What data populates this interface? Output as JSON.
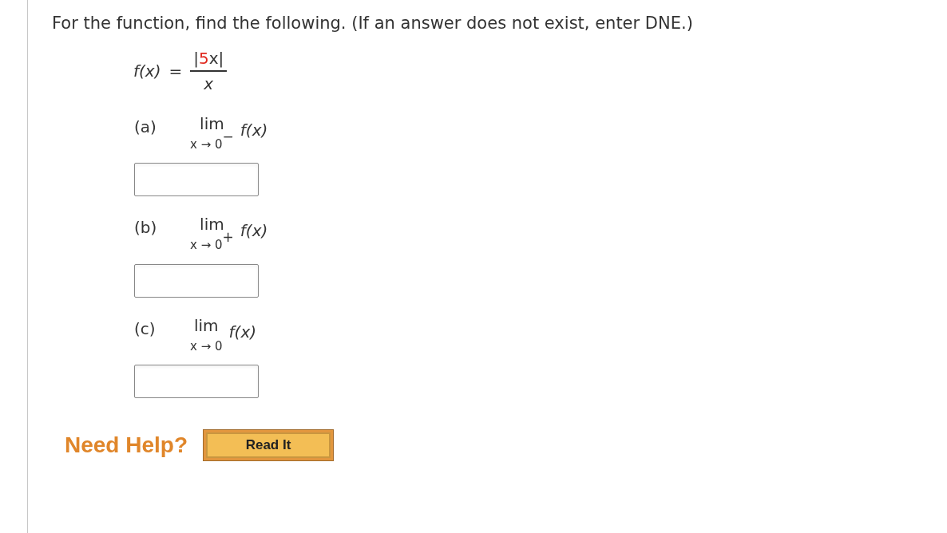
{
  "instruction": "For the function, find the following. (If an answer does not exist, enter DNE.)",
  "function": {
    "name": "f(x)",
    "equals": "=",
    "numerator": [
      {
        "text": "|",
        "color": "#333333"
      },
      {
        "text": "5",
        "color": "#e0281e"
      },
      {
        "text": "x|",
        "color": "#333333"
      }
    ],
    "denominator": "x"
  },
  "parts": [
    {
      "label": "(a)",
      "operator": "lim",
      "approach": "x → 0",
      "side": "−",
      "expression": "f(x)"
    },
    {
      "label": "(b)",
      "operator": "lim",
      "approach": "x → 0",
      "side": "+",
      "expression": "f(x)"
    },
    {
      "label": "(c)",
      "operator": "lim",
      "approach": "x → 0",
      "expression": "f(x)"
    }
  ],
  "help": {
    "label": "Need Help?",
    "button": "Read It"
  }
}
